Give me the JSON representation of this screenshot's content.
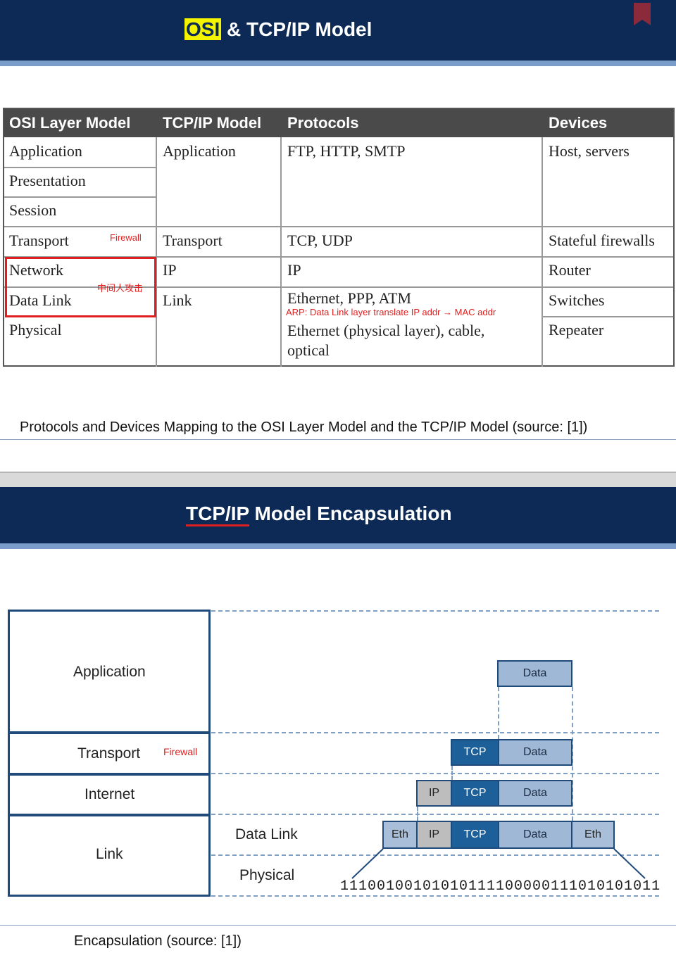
{
  "slide1": {
    "title_highlight": "OSI",
    "title_rest": " & TCP/IP Model",
    "table": {
      "headers": [
        "OSI Layer Model",
        "TCP/IP Model",
        "Protocols",
        "Devices"
      ],
      "osi_layers": [
        "Application",
        "Presentation",
        "Session",
        "Transport",
        "Network",
        "Data Link",
        "Physical"
      ],
      "tcpip": [
        "Application",
        "Transport",
        "IP",
        "Link"
      ],
      "protocols": [
        "FTP, HTTP, SMTP",
        "TCP, UDP",
        "IP",
        "Ethernet, PPP, ATM",
        "Ethernet (physical layer), cable,",
        "optical"
      ],
      "devices": [
        "Host, servers",
        "Stateful firewalls",
        "Router",
        "Switches",
        "Repeater"
      ]
    },
    "notes": {
      "firewall": "Firewall",
      "mitm": "中间人攻击",
      "arp": "ARP: Data Link layer translate IP addr → MAC addr"
    },
    "caption": "Protocols and Devices Mapping to the OSI Layer Model and the TCP/IP Model (source: [1])"
  },
  "slide2": {
    "title_underlined": "TCP/IP",
    "title_rest": " Model Encapsulation",
    "layers": [
      "Application",
      "Transport",
      "Internet",
      "Link"
    ],
    "sublayers": [
      "Data Link",
      "Physical"
    ],
    "firewall_note": "Firewall",
    "cells": {
      "data": "Data",
      "tcp": "TCP",
      "ip": "IP",
      "eth": "Eth"
    },
    "bits": "11100100101010111100000111010101011",
    "caption": "Encapsulation (source: [1])"
  },
  "colors": {
    "banner": "#0c2a55",
    "accent_red": "#e02020",
    "highlight_yellow": "#f4f400",
    "tcp_blue": "#1d5f99"
  }
}
